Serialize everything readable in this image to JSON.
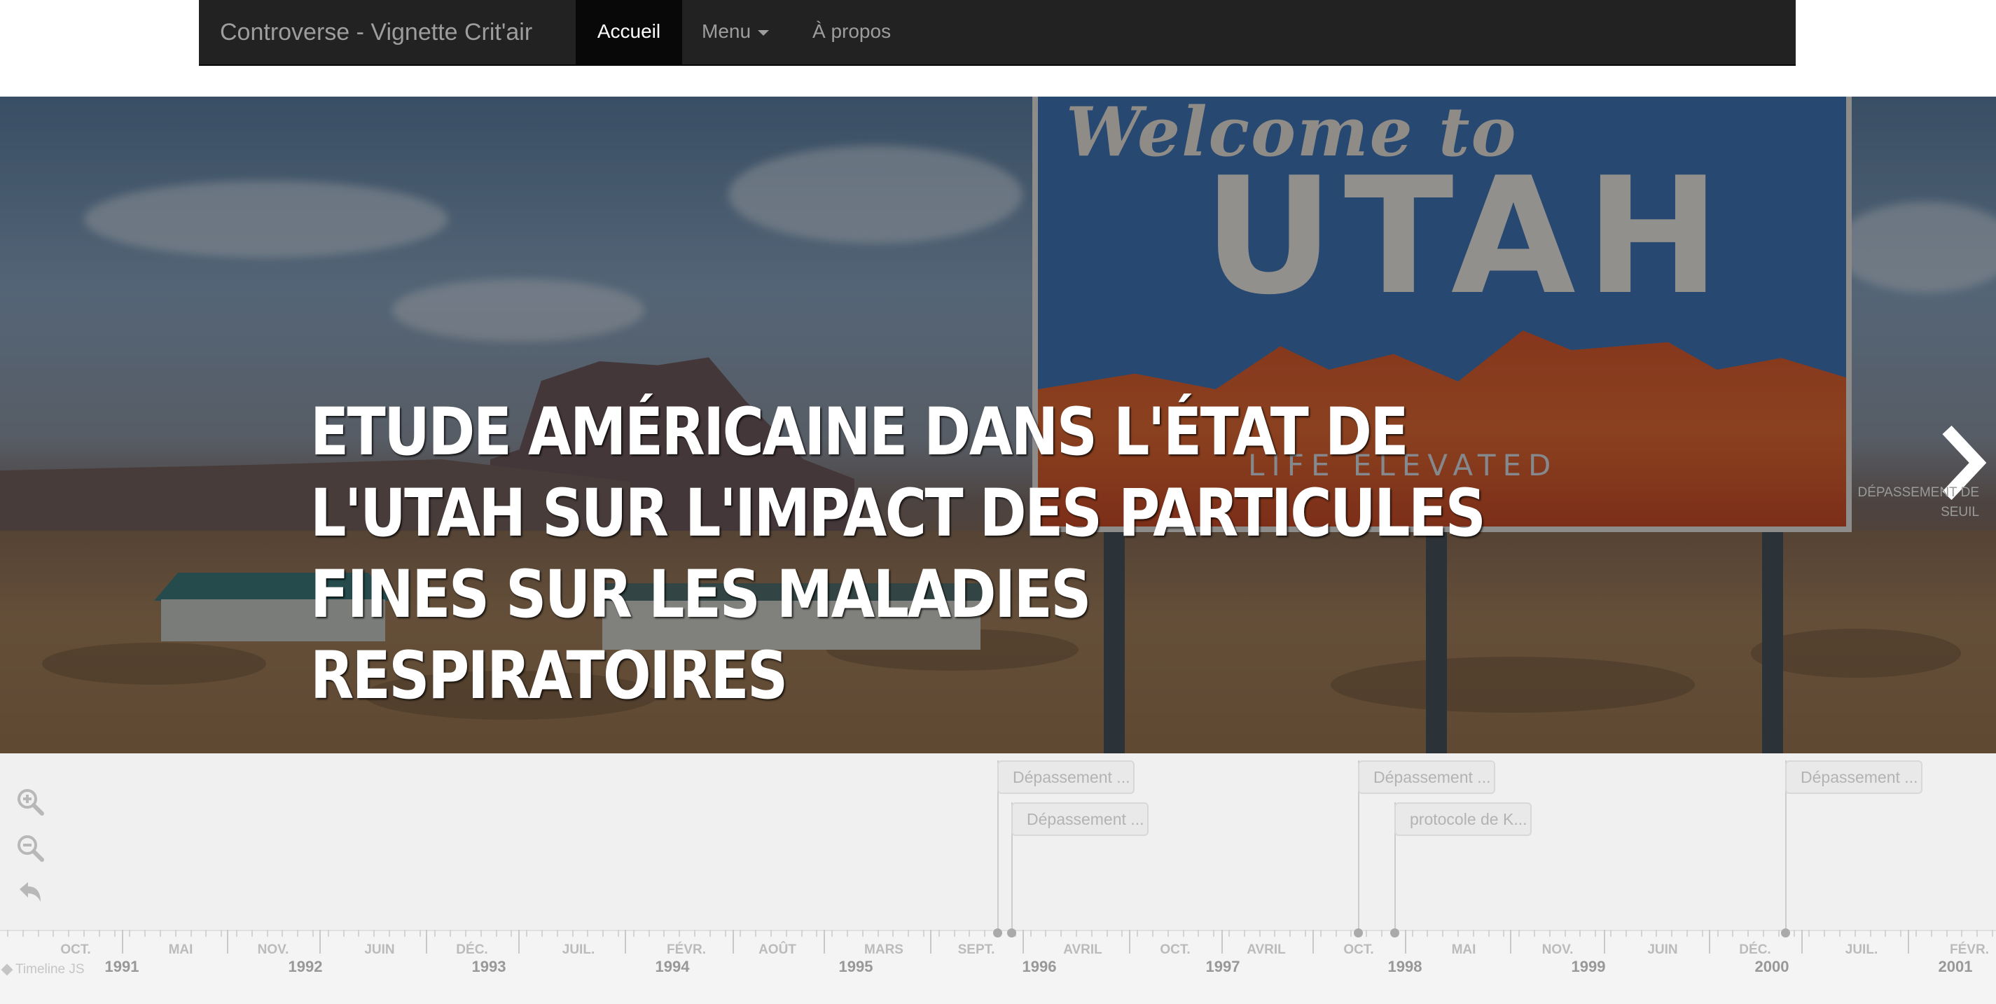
{
  "navbar": {
    "brand": "Controverse - Vignette Crit'air",
    "items": [
      {
        "label": "Accueil",
        "active": true
      },
      {
        "label": "Menu",
        "dropdown": true
      },
      {
        "label": "À propos"
      }
    ]
  },
  "slide": {
    "headline": "Etude américaine dans l'état de l'Utah sur l'impact des particules fines sur les maladies respiratoires",
    "image_sign": {
      "welcome": "Welcome to",
      "state": "UTAH",
      "motto": "LIFE ELEVATED"
    },
    "next": {
      "icon": "chevron-right-icon",
      "label": "Dépassement de seuil"
    }
  },
  "timeline": {
    "controls": [
      "zoom-in-icon",
      "zoom-out-icon",
      "back-to-start-icon"
    ],
    "markers": [
      "Dépassement ...",
      "Dépassement ...",
      "Dépassement ...",
      "protocole de K...",
      "Dépassement ..."
    ],
    "month_labels": [
      "OCT.",
      "MAI",
      "NOV.",
      "JUIN",
      "DÉC.",
      "JUIL.",
      "FÉVR.",
      "AOÛT",
      "MARS",
      "SEPT.",
      "AVRIL",
      "OCT.",
      "AVRIL",
      "OCT.",
      "MAI",
      "NOV.",
      "JUIN",
      "DÉC.",
      "JUIL.",
      "FÉVR."
    ],
    "year_labels": [
      "1991",
      "1992",
      "1993",
      "1994",
      "1995",
      "1996",
      "1997",
      "1998",
      "1999",
      "2000",
      "2001"
    ],
    "credit": "Timeline JS",
    "colors": {
      "marker_text": "#b3b3b3",
      "background": "#f0f0f0"
    }
  }
}
